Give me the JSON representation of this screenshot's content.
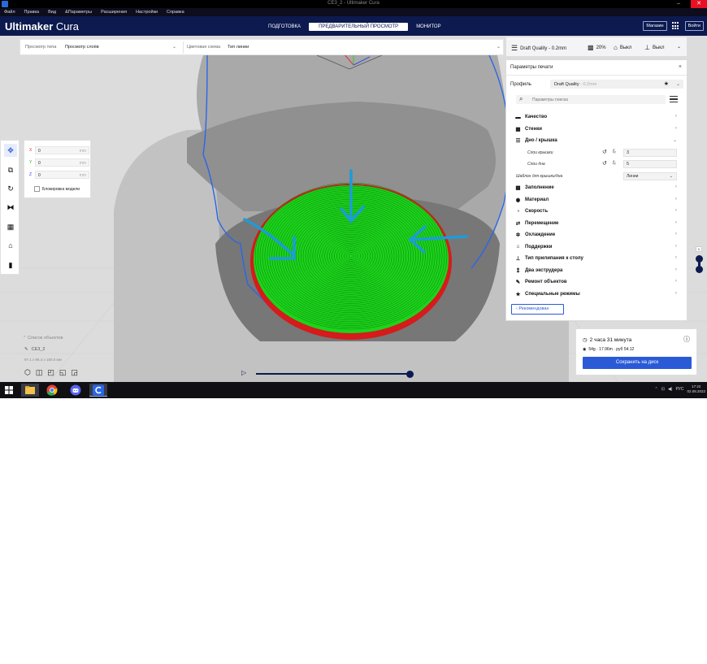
{
  "window": {
    "title": "CE3_2 - Ultimaker Cura",
    "minimize": "–",
    "close": "✕"
  },
  "menu": [
    "Файл",
    "Правка",
    "Вид",
    "&Параметры",
    "Расширения",
    "Настройки",
    "Справка"
  ],
  "header": {
    "logo_bold": "Ultimaker",
    "logo_thin": " Cura",
    "stages": [
      {
        "label": "ПОДГОТОВКА",
        "active": false
      },
      {
        "label": "ПРЕДВАРИТЕЛЬНЫЙ ПРОСМОТР",
        "active": true
      },
      {
        "label": "МОНИТОР",
        "active": false
      }
    ],
    "marketplace": "Магазин",
    "signin": "Войти"
  },
  "toolbar": {
    "view_type_label": "Просмотр типа",
    "view_type_value": "Просмотр слоёв",
    "color_scheme_label": "Цветовая схема",
    "color_scheme_value": "Тип линии"
  },
  "print_setup": {
    "profile": "Draft Quality - 0.2mm",
    "infill": "20%",
    "support": "Выкл",
    "adhesion": "Выкл"
  },
  "panel": {
    "title": "Параметры печати",
    "close": "×",
    "profile_label": "Профиль",
    "profile_value": "Draft Quality",
    "profile_suffix": " - 0.2mm",
    "search_placeholder": "Параметры поиска",
    "categories": [
      {
        "icon": "▬",
        "name": "quality-icon",
        "label": "Качество",
        "expanded": false
      },
      {
        "icon": "▦",
        "name": "walls-icon",
        "label": "Стенки",
        "expanded": false
      },
      {
        "icon": "☰",
        "name": "topbottom-icon",
        "label": "Дно / крышка",
        "expanded": true
      }
    ],
    "topbottom": {
      "top_layers_label": "Слои крышки",
      "top_layers_value": "3",
      "bottom_layers_label": "Слои дна",
      "bottom_layers_value": "5",
      "pattern_label": "Шаблон для крышки/дна",
      "pattern_value": "Линии"
    },
    "categories_rest": [
      {
        "icon": "▩",
        "name": "infill-icon",
        "label": "Заполнение"
      },
      {
        "icon": "◉",
        "name": "material-icon",
        "label": "Материал"
      },
      {
        "icon": "◔",
        "name": "speed-icon",
        "label": "Скорость"
      },
      {
        "icon": "⇄",
        "name": "travel-icon",
        "label": "Перемещение"
      },
      {
        "icon": "✲",
        "name": "cooling-icon",
        "label": "Охлаждение"
      },
      {
        "icon": "⌂",
        "name": "support-icon",
        "label": "Поддержки"
      },
      {
        "icon": "⊥",
        "name": "adhesion-icon",
        "label": "Тип прилипания к столу"
      },
      {
        "icon": "⁑",
        "name": "dual-extrusion-icon",
        "label": "Два экструдера"
      },
      {
        "icon": "✎",
        "name": "mesh-fixes-icon",
        "label": "Ремонт объектов"
      },
      {
        "icon": "★",
        "name": "special-modes-icon",
        "label": "Специальные режимы"
      }
    ],
    "recommended_label": "Рекомендован"
  },
  "move": {
    "x_label": "X",
    "x_value": "0",
    "y_label": "Y",
    "y_value": "0",
    "z_label": "Z",
    "z_value": "0",
    "unit": "mm",
    "lock_label": "Блокировка модели"
  },
  "objects": {
    "list_label": "Список объектов",
    "name": "CE3_2",
    "dims": "97.1 x 96.4 x 160.0 мм"
  },
  "layer_slider": {
    "top_layer": "1",
    "progress": 1.0
  },
  "estimate": {
    "time": "2 часа 31 минута",
    "material": "54g · 17.96m · руб 54.12",
    "save_label": "Сохранить на диск"
  },
  "taskbar": {
    "lang": "РУС",
    "time": "17:22",
    "date": "02.08.2022"
  },
  "colors": {
    "header": "#0c1a4f",
    "accent": "#2a5ad6",
    "layer_green": "#1bd31b",
    "layer_red": "#d51b1b",
    "annotation_arrow": "#1e9bd8",
    "model_outline": "#2a66e8"
  }
}
